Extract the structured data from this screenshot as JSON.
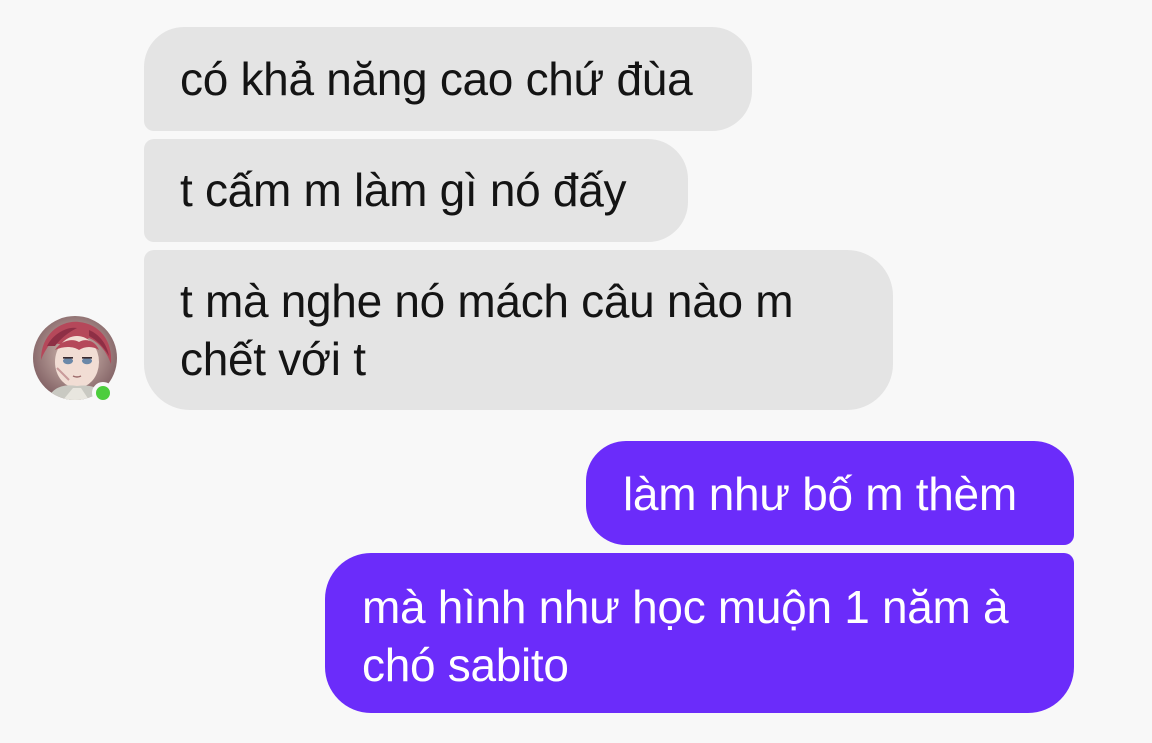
{
  "contact": {
    "avatar_icon": "contact-avatar-icon",
    "online": true,
    "online_color": "#4ccd3d"
  },
  "messages": [
    {
      "sender": "contact",
      "lines": [
        "có khả năng cao chứ đùa"
      ]
    },
    {
      "sender": "contact",
      "lines": [
        "t cấm m làm gì nó đấy"
      ]
    },
    {
      "sender": "contact",
      "lines": [
        "t mà nghe nó mách câu nào m",
        "chết với t"
      ]
    },
    {
      "sender": "me",
      "lines": [
        "làm như bố m thèm"
      ]
    },
    {
      "sender": "me",
      "lines": [
        "mà hình như học muộn 1 năm à",
        "chó sabito"
      ]
    }
  ],
  "colors": {
    "incoming_bubble": "#e4e4e4",
    "outgoing_bubble": "#6b2cfa",
    "background": "#f8f8f8"
  }
}
